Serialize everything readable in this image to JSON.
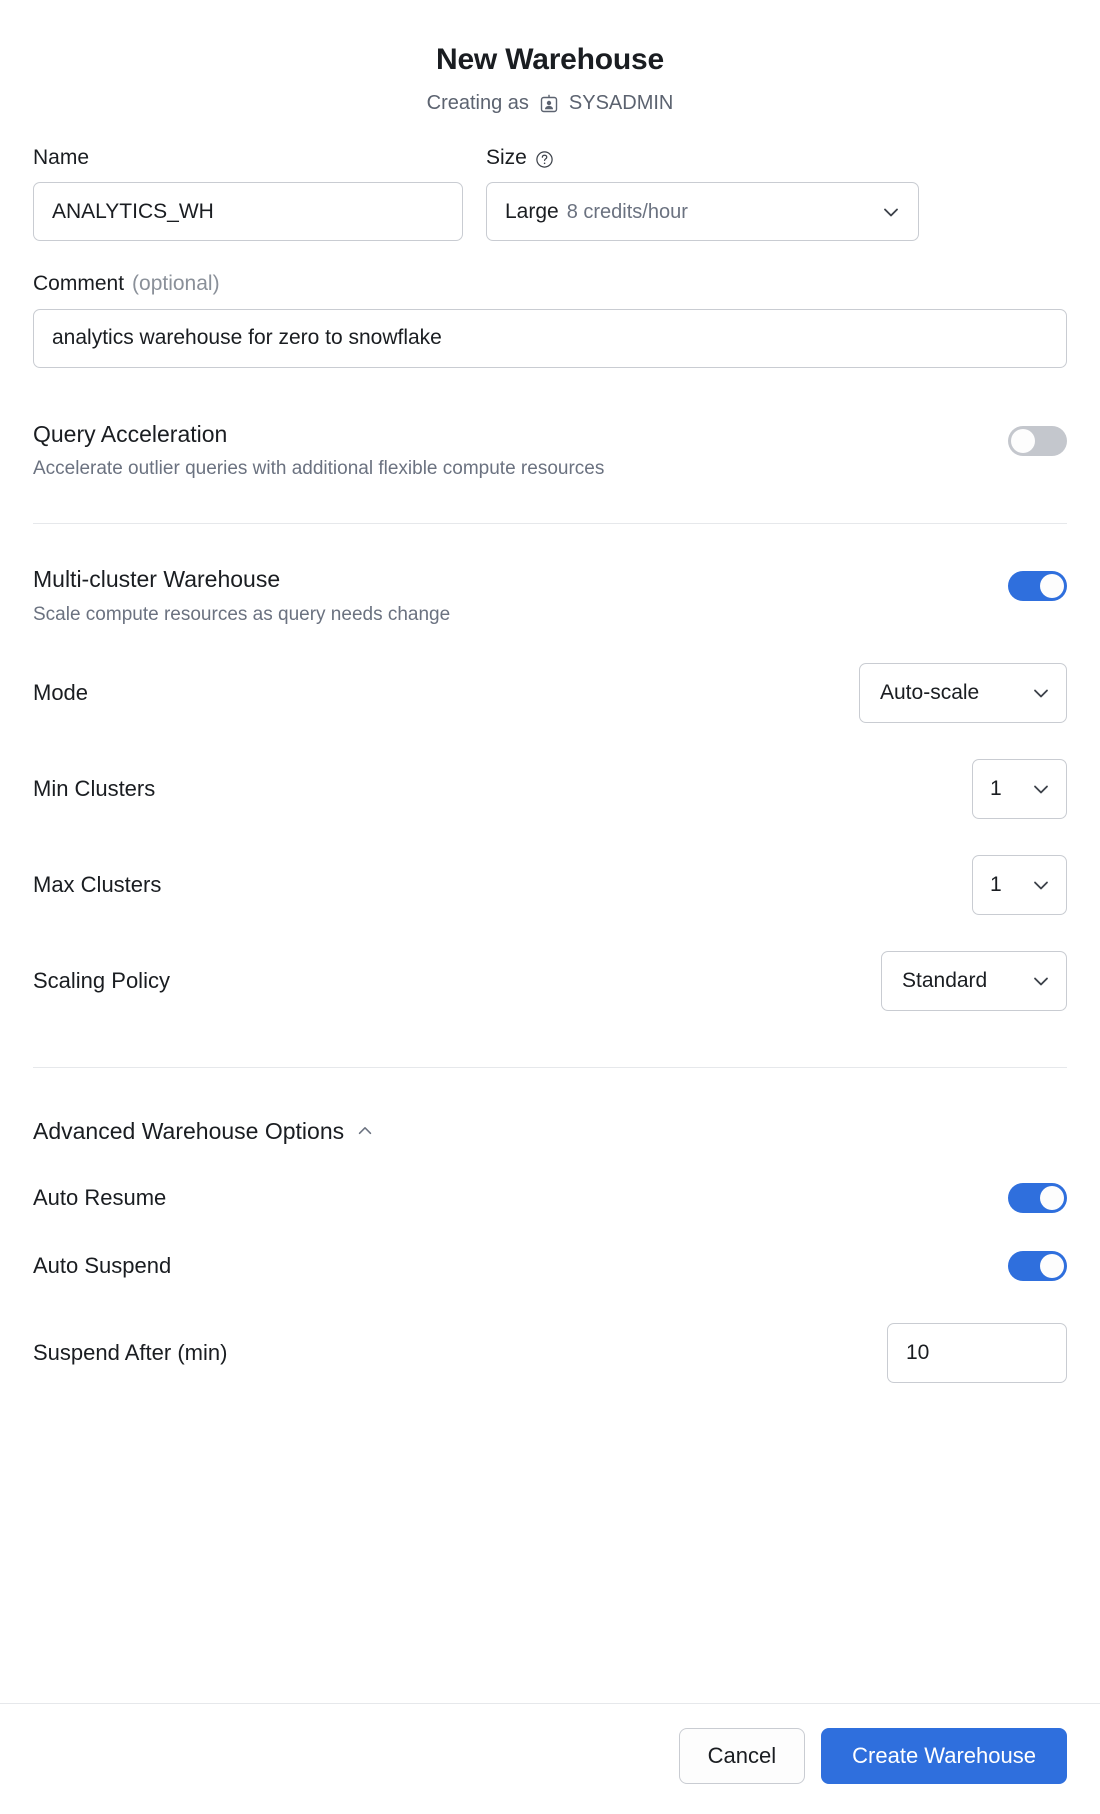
{
  "header": {
    "title": "New Warehouse",
    "creating_as_prefix": "Creating as",
    "role_icon": "user-badge-icon",
    "role": "SYSADMIN"
  },
  "form": {
    "name": {
      "label": "Name",
      "value": "ANALYTICS_WH",
      "placeholder": "Warehouse name"
    },
    "size": {
      "label": "Size",
      "help_icon": "help-circle-icon",
      "value": "Large",
      "value_detail": "8 credits/hour",
      "chevron": "chevron-down-icon"
    },
    "comment": {
      "label": "Comment",
      "label_optional": "(optional)",
      "value": "analytics warehouse for zero to snowflake",
      "placeholder": "Comment"
    }
  },
  "query_acceleration": {
    "title": "Query Acceleration",
    "subtitle": "Accelerate outlier queries with additional flexible compute resources",
    "enabled": false
  },
  "multi_cluster": {
    "title": "Multi-cluster Warehouse",
    "subtitle": "Scale compute resources as query needs change",
    "enabled": true,
    "controls": [
      {
        "label": "Mode",
        "value": "Auto-scale",
        "width": "w-mode"
      },
      {
        "label": "Min Clusters",
        "value": "1",
        "width": "w-num"
      },
      {
        "label": "Max Clusters",
        "value": "1",
        "width": "w-num"
      },
      {
        "label": "Scaling Policy",
        "value": "Standard",
        "width": "w-pol"
      }
    ]
  },
  "advanced": {
    "title": "Advanced Warehouse Options",
    "collapse_icon": "chevron-up-icon",
    "expanded": true,
    "auto_resume": {
      "label": "Auto Resume",
      "enabled": true
    },
    "auto_suspend": {
      "label": "Auto Suspend",
      "enabled": true
    },
    "suspend_after": {
      "label": "Suspend After (min)",
      "value": "10"
    }
  },
  "footer": {
    "cancel_label": "Cancel",
    "submit_label": "Create Warehouse"
  },
  "colors": {
    "accent": "#2f6fdd",
    "toggle_on": "#2f6fdd",
    "toggle_off": "#c4c7cd",
    "text": "#1a1d21",
    "muted": "#6b7280",
    "border": "#c9ccd2"
  }
}
